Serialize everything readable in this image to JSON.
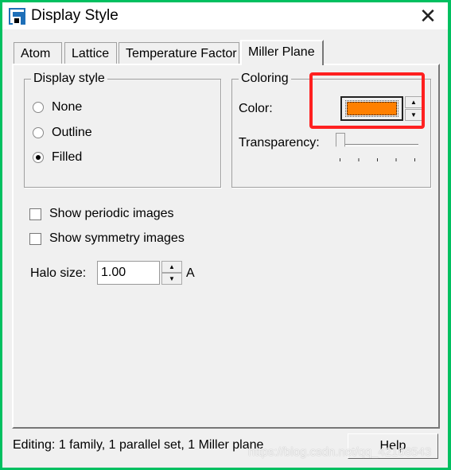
{
  "window": {
    "title": "Display Style",
    "close_icon": "close-icon"
  },
  "tabs": [
    {
      "label": "Atom"
    },
    {
      "label": "Lattice"
    },
    {
      "label": "Temperature Factor"
    },
    {
      "label": "Miller Plane",
      "active": true
    }
  ],
  "display_style": {
    "label": "Display style",
    "options": [
      {
        "label": "None",
        "selected": false
      },
      {
        "label": "Outline",
        "selected": false
      },
      {
        "label": "Filled",
        "selected": true
      }
    ]
  },
  "coloring": {
    "label": "Coloring",
    "color_label": "Color:",
    "color_value": "#ff8000",
    "transparency_label": "Transparency:",
    "transparency_value": 0
  },
  "checkboxes": [
    {
      "label": "Show periodic images",
      "checked": false
    },
    {
      "label": "Show symmetry images",
      "checked": false
    }
  ],
  "halo": {
    "label": "Halo size:",
    "value": "1.00",
    "unit": "A"
  },
  "status": "Editing: 1 family, 1 parallel set, 1 Miller plane",
  "help_label": "Help",
  "watermark": "https://blog.csdn.net/qq_42168543",
  "highlight_color": "#ff2020"
}
